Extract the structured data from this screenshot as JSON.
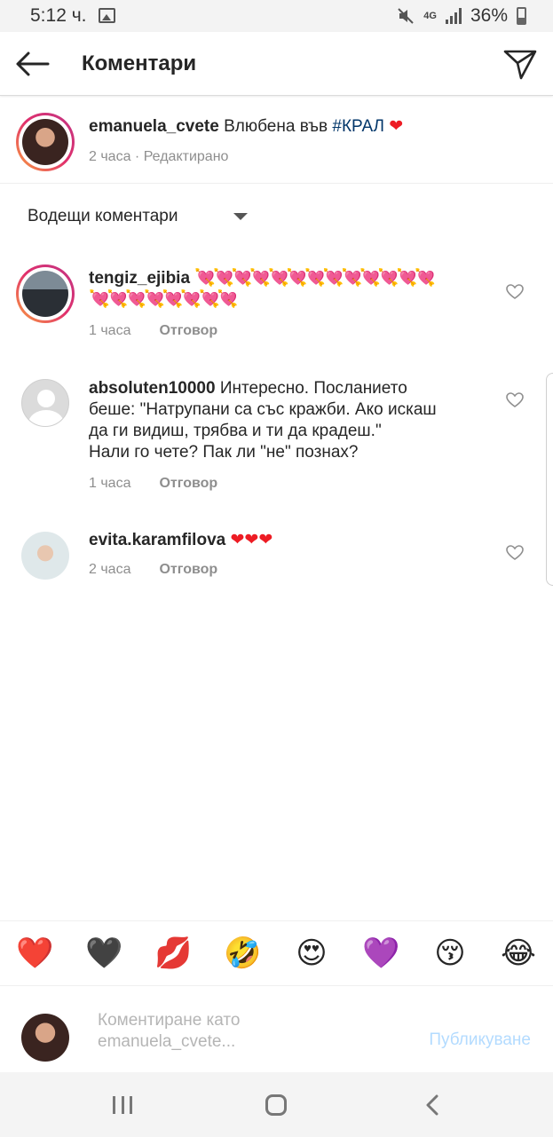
{
  "status_bar": {
    "time": "5:12 ч.",
    "network": "4G",
    "battery": "36%"
  },
  "header": {
    "title": "Коментари"
  },
  "caption": {
    "username": "emanuela_cvete",
    "text": "Влюбена във",
    "hashtag": "#КРАЛ",
    "emoji": "❤",
    "meta": "2 часа · Редактирано"
  },
  "sort": {
    "label": "Водещи коментари"
  },
  "comments": [
    {
      "username": "tengiz_ejibia",
      "line1": "💘💘💘💘💘💘💘💘💘💘💘💘💘",
      "line2": "💘💘💘💘💘💘💘💘",
      "time": "1 часа",
      "reply": "Отговор"
    },
    {
      "username": "absoluten10000",
      "line1": "Интересно. Посланието",
      "line2": "беше: \"Натрупани са със кражби. Ако искаш",
      "line3": "да ги видиш, трябва и ти да крадеш.\"",
      "line4": "Нали го чете? Пак ли \"не\" познах?",
      "time": "1 часа",
      "reply": "Отговор"
    },
    {
      "username": "evita.karamfilova",
      "line1": "❤❤❤",
      "time": "2 часа",
      "reply": "Отговор"
    }
  ],
  "emoji_bar": [
    "❤️",
    "🖤",
    "💋",
    "🤣",
    "😍",
    "💜",
    "😚",
    "😂"
  ],
  "composer": {
    "placeholder_line1": "Коментиране като",
    "placeholder_line2": "emanuela_cvete...",
    "post_label": "Публикуване"
  },
  "colors": {
    "link": "#003569",
    "muted": "#8e8e8e",
    "post_disabled": "#b3dbff"
  }
}
